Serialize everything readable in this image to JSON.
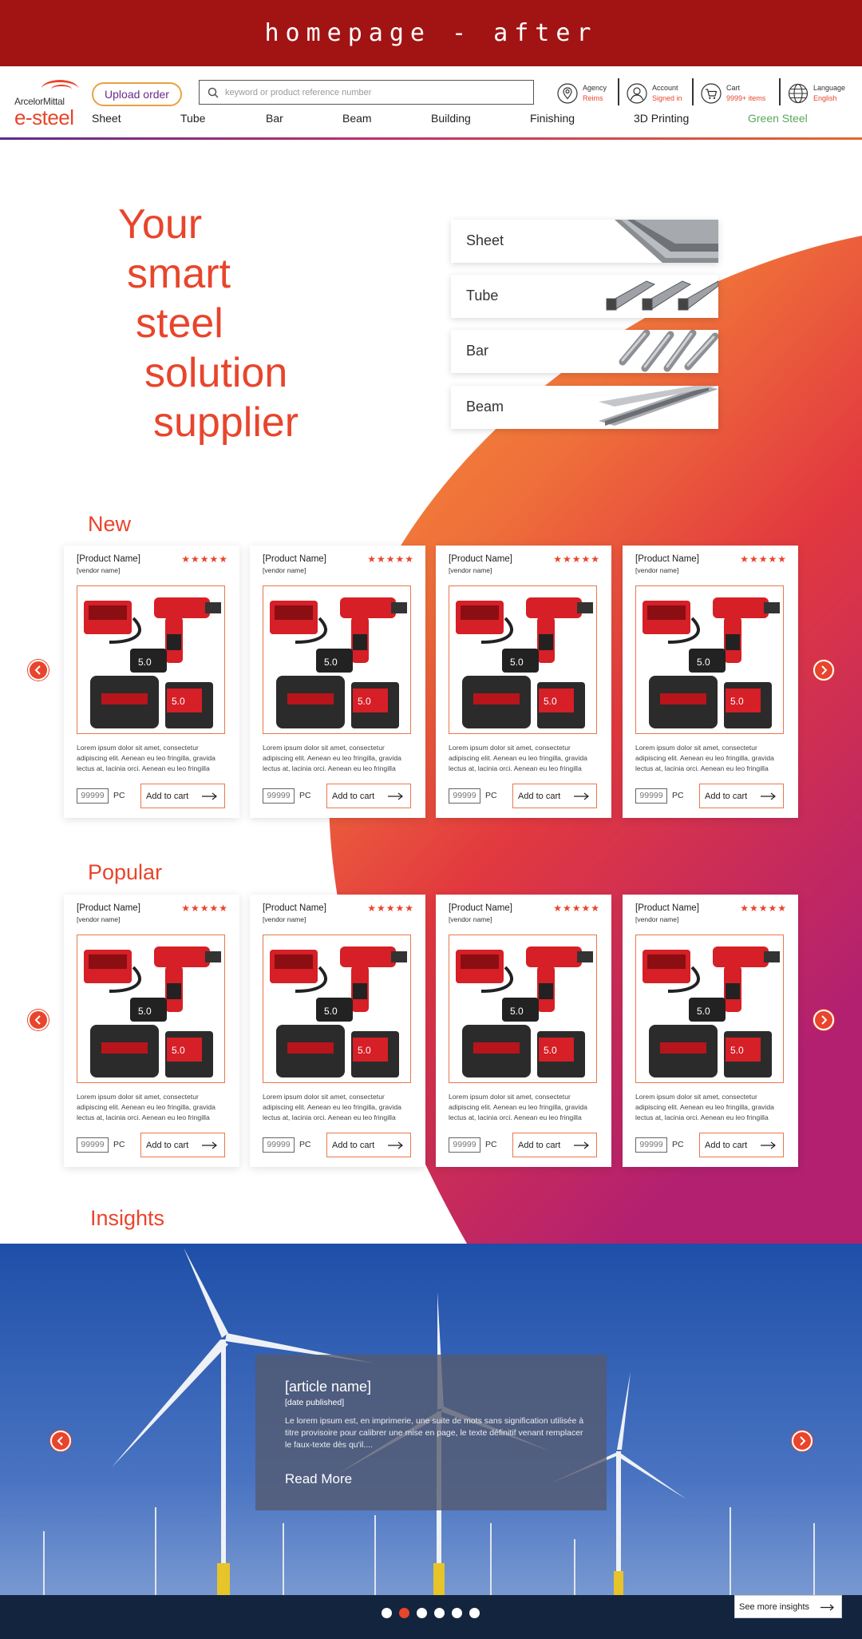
{
  "page_title": "homepage - after",
  "logo": {
    "brand": "ArcelorMittal",
    "product": "e-steel"
  },
  "header": {
    "upload_label": "Upload order",
    "search_placeholder": "keyword or product reference number",
    "agency": {
      "label": "Agency",
      "value": "Reims"
    },
    "account": {
      "label": "Account",
      "value": "Signed in"
    },
    "cart": {
      "label": "Cart",
      "value": "9999+ items"
    },
    "language": {
      "label": "Language",
      "value": "English"
    }
  },
  "nav": [
    "Sheet",
    "Tube",
    "Bar",
    "Beam",
    "Building",
    "Finishing",
    "3D Printing",
    "Green Steel"
  ],
  "hero": {
    "lines": [
      "Your",
      "smart",
      "steel",
      "solution",
      "supplier"
    ],
    "categories": [
      "Sheet",
      "Tube",
      "Bar",
      "Beam"
    ]
  },
  "sections": {
    "new": "New",
    "popular": "Popular",
    "insights": "Insights"
  },
  "product": {
    "name": "[Product Name]",
    "vendor": "[vendor name]",
    "stars": "★★★★★",
    "description": "Lorem ipsum dolor sit amet, consectetur adipiscing elit. Aenean eu leo fringilla, gravida lectus at, lacinia orci. Aenean eu leo fringilla",
    "qty": "99999",
    "unit": "PC",
    "add_to_cart": "Add to cart"
  },
  "article": {
    "name": "[article name]",
    "date": "[date published]",
    "excerpt": "Le lorem ipsum est, en imprimerie, une suite de mots sans signification utilisée à titre provisoire pour calibrer une mise en page, le texte définitif venant remplacer le faux-texte dès qu'il....",
    "read_more": "Read More"
  },
  "see_more_insights": "See more insights",
  "colors": {
    "brand_red": "#a11413",
    "accent_orange": "#e8452c",
    "green": "#5aa85a"
  }
}
